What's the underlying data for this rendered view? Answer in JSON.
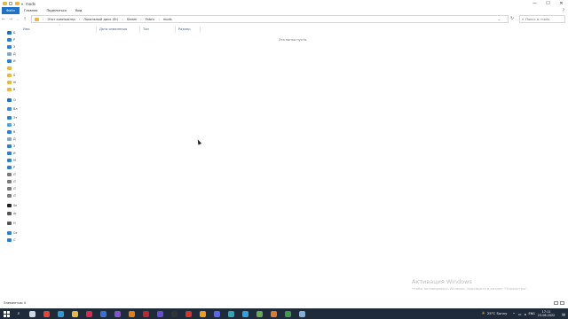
{
  "window": {
    "title": "mods",
    "controls": {
      "minimize": "—",
      "maximize": "☐",
      "close": "✕"
    }
  },
  "ribbon": {
    "tabs": [
      "Файл",
      "Главная",
      "Поделиться",
      "Вид"
    ],
    "help_icon": "?"
  },
  "address": {
    "breadcrumbs": [
      "Этот компьютер",
      "Локальный диск (D:)",
      "Steam",
      "Fabric",
      "mods"
    ],
    "search_placeholder": "Поиск в: mods"
  },
  "nav_pane": {
    "items": [
      {
        "label": "Б",
        "icon": "quick-access-icon",
        "color": "#1f6fcf"
      },
      {
        "label": "Р",
        "icon": "desktop-icon",
        "color": "#2b7fd6"
      },
      {
        "label": "З",
        "icon": "downloads-icon",
        "color": "#2b7fd6"
      },
      {
        "label": "Д",
        "icon": "documents-icon",
        "color": "#8aa5c4"
      },
      {
        "label": "И",
        "icon": "pictures-icon",
        "color": "#2b7fd6"
      },
      {
        "label": "",
        "icon": "folder-icon",
        "color": "#e8b93a"
      },
      {
        "label": "S",
        "icon": "folder-icon",
        "color": "#e8b93a"
      },
      {
        "label": "m",
        "icon": "folder-icon",
        "color": "#e8b93a"
      },
      {
        "label": "B",
        "icon": "folder-icon",
        "color": "#e8b93a"
      },
      {
        "label": "O",
        "icon": "onedrive-icon",
        "color": "#1f6fcf"
      },
      {
        "label": "Вл",
        "icon": "attachments-icon",
        "color": "#3a8ae0"
      },
      {
        "label": "Эт",
        "icon": "this-pc-icon",
        "color": "#2b7fd6"
      },
      {
        "label": "З",
        "icon": "3d-objects-icon",
        "color": "#4aa3e0"
      },
      {
        "label": "В",
        "icon": "videos-icon",
        "color": "#2b7fd6"
      },
      {
        "label": "Д",
        "icon": "documents-icon",
        "color": "#8aa5c4"
      },
      {
        "label": "З",
        "icon": "downloads-icon",
        "color": "#2b7fd6"
      },
      {
        "label": "И",
        "icon": "pictures-icon",
        "color": "#2b7fd6"
      },
      {
        "label": "М",
        "icon": "music-icon",
        "color": "#2b7fd6"
      },
      {
        "label": "Р",
        "icon": "desktop-icon",
        "color": "#2b7fd6"
      },
      {
        "label": "Л",
        "icon": "drive-icon",
        "color": "#7a7a7a"
      },
      {
        "label": "Л",
        "icon": "drive-icon",
        "color": "#7a7a7a"
      },
      {
        "label": "Л",
        "icon": "drive-icon",
        "color": "#7a7a7a"
      },
      {
        "label": "Л",
        "icon": "drive-icon",
        "color": "#7a7a7a"
      },
      {
        "label": "Se",
        "icon": "phone-icon",
        "color": "#222222"
      },
      {
        "label": "Ar",
        "icon": "drive-icon",
        "color": "#555555"
      },
      {
        "label": "H",
        "icon": "drive-icon",
        "color": "#555555"
      },
      {
        "label": "Ce",
        "icon": "network-icon",
        "color": "#2b7fd6"
      },
      {
        "label": "C",
        "icon": "network-icon",
        "color": "#2b7fd6"
      }
    ]
  },
  "columns": [
    "Имя",
    "Дата изменения",
    "Тип",
    "Размер"
  ],
  "empty_message": "Эта папка пуста.",
  "status": {
    "text": "Элементов: 0"
  },
  "watermark": {
    "title": "Активация Windows",
    "subtitle": "Чтобы активировать Windows, перейдите в раздел \"Параметры\"."
  },
  "taskbar": {
    "apps": [
      {
        "name": "taskview",
        "color": "#cfd8e3"
      },
      {
        "name": "chrome",
        "color": "#e94335"
      },
      {
        "name": "edge",
        "color": "#2a9bd6"
      },
      {
        "name": "explorer",
        "color": "#e8b93a"
      },
      {
        "name": "opera-gx",
        "color": "#e0284d"
      },
      {
        "name": "app-blue",
        "color": "#3a6fd8"
      },
      {
        "name": "visual-studio",
        "color": "#8a4fd1"
      },
      {
        "name": "blender",
        "color": "#e87d0d"
      },
      {
        "name": "filezilla",
        "color": "#c0262c"
      },
      {
        "name": "app-purple",
        "color": "#6a4bd8"
      },
      {
        "name": "obs",
        "color": "#333333"
      },
      {
        "name": "yandex",
        "color": "#d9342b"
      },
      {
        "name": "app-orange",
        "color": "#f29a1a"
      },
      {
        "name": "discord",
        "color": "#5865f2"
      },
      {
        "name": "app-teal",
        "color": "#2aa7b8"
      },
      {
        "name": "telegram",
        "color": "#2aa3e0"
      },
      {
        "name": "minecraft",
        "color": "#6aa84f"
      },
      {
        "name": "java",
        "color": "#e07a2a"
      },
      {
        "name": "app-green",
        "color": "#3c9a4a"
      },
      {
        "name": "notepad",
        "color": "#7fb0e0"
      }
    ],
    "weather": {
      "temp": "25°C",
      "condition": "Sunny"
    },
    "lang": "ENG",
    "time": "17:11",
    "date": "23.08.2022"
  }
}
